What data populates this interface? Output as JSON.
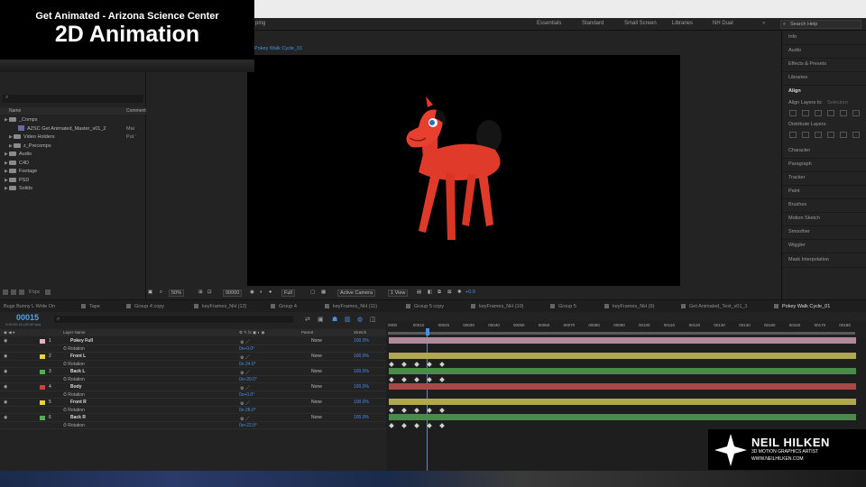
{
  "title": {
    "line1": "Get Animated - Arizona Science Center",
    "line2": "2D Animation"
  },
  "workspace": {
    "items": [
      "Essentials",
      "Standard",
      "Small Screen",
      "Libraries",
      "NH Dual"
    ],
    "search_placeholder": "Search Help",
    "fragment": "ping"
  },
  "project": {
    "columns": {
      "name": "Name",
      "comment": "Comment"
    },
    "rows": [
      {
        "label": "_Comps",
        "kind": "folder",
        "indent": 0
      },
      {
        "label": "AZSC Get Animated_Master_v01_2",
        "kind": "comp",
        "indent": 2,
        "comment": "Mai"
      },
      {
        "label": "Video Holders",
        "kind": "folder",
        "indent": 1,
        "comment": "Put '"
      },
      {
        "label": "z_Precomps",
        "kind": "folder",
        "indent": 1
      },
      {
        "label": "Audio",
        "kind": "folder",
        "indent": 0
      },
      {
        "label": "C4D",
        "kind": "folder",
        "indent": 0
      },
      {
        "label": "Footage",
        "kind": "folder",
        "indent": 0
      },
      {
        "label": "PSD",
        "kind": "folder",
        "indent": 0
      },
      {
        "label": "Solids",
        "kind": "folder",
        "indent": 0
      }
    ],
    "footer": "8 bpc"
  },
  "viewer": {
    "comp_tab": "Pokey Walk Cycle_01",
    "zoom": "50%",
    "timecode": "00000",
    "resolution": "Full",
    "camera": "Active Camera",
    "view": "1 View",
    "offset": "+0.0"
  },
  "right_panel": {
    "items": [
      "Info",
      "Audio",
      "Effects & Presets",
      "Libraries",
      "Align",
      "Character",
      "Paragraph",
      "Tracker",
      "Paint",
      "Brushes",
      "Motion Sketch",
      "Smoother",
      "Wiggler",
      "Mask Interpolation"
    ],
    "align_to_label": "Align Layers to:",
    "align_to_value": "Selection",
    "distribute_label": "Distribute Layers:"
  },
  "timeline_tabs": [
    "Bugs Bunny L Write On",
    "Tape",
    "Group 4 copy",
    "keyFrames_NH (12)",
    "Group 4",
    "keyFrames_NH (11)",
    "Group 5 copy",
    "keyFrames_NH (10)",
    "Group 5",
    "keyFrames_NH (9)",
    "Get Animated_Text_v01_1",
    "Pokey Walk Cycle_01"
  ],
  "timeline": {
    "timecode": "00015",
    "timecode_sub": "0:00:00:15 (30.00 fps)",
    "headers": {
      "layer_name": "Layer Name",
      "parent": "Parent",
      "stretch": "Stretch"
    },
    "ruler_ticks": [
      "0000",
      "00010",
      "00020",
      "00030",
      "00040",
      "00050",
      "00060",
      "00070",
      "00080",
      "00090",
      "00100",
      "00110",
      "00120",
      "00130",
      "00140",
      "00150",
      "00160",
      "00170",
      "00180"
    ],
    "layers": [
      {
        "num": "1",
        "name": "Pokey Full",
        "color": "#e8b0c0",
        "parent": "None",
        "stretch": "100.0%",
        "prop": "Rotation",
        "prop_value": "0x+0.0°",
        "bar_color": "#b08a9a",
        "keyframes": []
      },
      {
        "num": "2",
        "name": "Front L",
        "color": "#e8d040",
        "parent": "None",
        "stretch": "100.0%",
        "prop": "Rotation",
        "prop_value": "0x-24.0°",
        "bar_color": "#b0a850",
        "keyframes": [
          0,
          5,
          10,
          15,
          20
        ]
      },
      {
        "num": "3",
        "name": "Back L",
        "color": "#50b050",
        "parent": "None",
        "stretch": "100.0%",
        "prop": "Rotation",
        "prop_value": "0x+20.0°",
        "bar_color": "#4a8a4a",
        "keyframes": [
          0,
          5,
          10,
          15,
          20
        ]
      },
      {
        "num": "4",
        "name": "Body",
        "color": "#d04040",
        "parent": "None",
        "stretch": "100.0%",
        "prop": "Rotation",
        "prop_value": "0x+0.0°",
        "bar_color": "#a84848",
        "keyframes": []
      },
      {
        "num": "5",
        "name": "Front R",
        "color": "#e8d040",
        "parent": "None",
        "stretch": "100.0%",
        "prop": "Rotation",
        "prop_value": "0x-28.0°",
        "bar_color": "#b0a850",
        "keyframes": [
          0,
          5,
          10,
          15,
          20
        ]
      },
      {
        "num": "6",
        "name": "Back R",
        "color": "#50b050",
        "parent": "None",
        "stretch": "100.0%",
        "prop": "Rotation",
        "prop_value": "0x+22.0°",
        "bar_color": "#4a8a4a",
        "keyframes": [
          0,
          5,
          10,
          15,
          20
        ]
      }
    ]
  },
  "logo": {
    "name": "NEIL HILKEN",
    "subtitle": "3D MOTION GRAPHICS ARTIST",
    "url": "WWW.NEILHILKEN.COM"
  }
}
